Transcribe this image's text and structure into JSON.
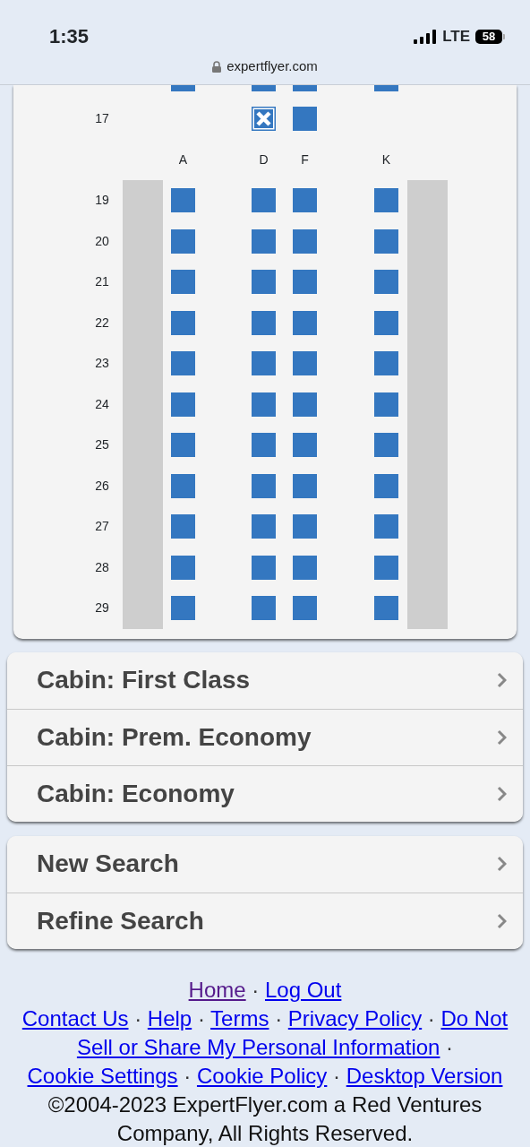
{
  "status_bar": {
    "time": "1:35",
    "network": "LTE",
    "battery": "58"
  },
  "address_bar": {
    "url": "expertflyer.com"
  },
  "seat_map": {
    "columns": [
      "A",
      "D",
      "F",
      "K"
    ],
    "rows": [
      {
        "kind": "partial",
        "seats": [
          {
            "kind": "seat",
            "occupied": false
          },
          {
            "kind": "seat",
            "occupied": false
          },
          {
            "kind": "seat",
            "occupied": false
          },
          {
            "kind": "seat",
            "occupied": false
          }
        ]
      },
      {
        "kind": "seats",
        "number": "17",
        "seats": [
          {
            "kind": "space"
          },
          {
            "kind": "seat",
            "occupied": true
          },
          {
            "kind": "seat",
            "occupied": false
          },
          {
            "kind": "space"
          }
        ]
      },
      {
        "kind": "header"
      },
      {
        "kind": "seats",
        "number": "19",
        "seats": [
          {
            "kind": "seat",
            "occupied": false
          },
          {
            "kind": "seat",
            "occupied": false
          },
          {
            "kind": "seat",
            "occupied": false
          },
          {
            "kind": "seat",
            "occupied": false
          }
        ]
      },
      {
        "kind": "seats",
        "number": "20",
        "seats": [
          {
            "kind": "seat",
            "occupied": false
          },
          {
            "kind": "seat",
            "occupied": false
          },
          {
            "kind": "seat",
            "occupied": false
          },
          {
            "kind": "seat",
            "occupied": false
          }
        ]
      },
      {
        "kind": "seats",
        "number": "21",
        "seats": [
          {
            "kind": "seat",
            "occupied": false
          },
          {
            "kind": "seat",
            "occupied": false
          },
          {
            "kind": "seat",
            "occupied": false
          },
          {
            "kind": "seat",
            "occupied": false
          }
        ]
      },
      {
        "kind": "seats",
        "number": "22",
        "seats": [
          {
            "kind": "seat",
            "occupied": false
          },
          {
            "kind": "seat",
            "occupied": false
          },
          {
            "kind": "seat",
            "occupied": false
          },
          {
            "kind": "seat",
            "occupied": false
          }
        ]
      },
      {
        "kind": "seats",
        "number": "23",
        "seats": [
          {
            "kind": "seat",
            "occupied": false
          },
          {
            "kind": "seat",
            "occupied": false
          },
          {
            "kind": "seat",
            "occupied": false
          },
          {
            "kind": "seat",
            "occupied": false
          }
        ]
      },
      {
        "kind": "seats",
        "number": "24",
        "seats": [
          {
            "kind": "seat",
            "occupied": false
          },
          {
            "kind": "seat",
            "occupied": false
          },
          {
            "kind": "seat",
            "occupied": false
          },
          {
            "kind": "seat",
            "occupied": false
          }
        ]
      },
      {
        "kind": "seats",
        "number": "25",
        "seats": [
          {
            "kind": "seat",
            "occupied": false
          },
          {
            "kind": "seat",
            "occupied": false
          },
          {
            "kind": "seat",
            "occupied": false
          },
          {
            "kind": "seat",
            "occupied": false
          }
        ]
      },
      {
        "kind": "seats",
        "number": "26",
        "seats": [
          {
            "kind": "seat",
            "occupied": false
          },
          {
            "kind": "seat",
            "occupied": false
          },
          {
            "kind": "seat",
            "occupied": false
          },
          {
            "kind": "seat",
            "occupied": false
          }
        ]
      },
      {
        "kind": "seats",
        "number": "27",
        "seats": [
          {
            "kind": "seat",
            "occupied": false
          },
          {
            "kind": "seat",
            "occupied": false
          },
          {
            "kind": "seat",
            "occupied": false
          },
          {
            "kind": "seat",
            "occupied": false
          }
        ]
      },
      {
        "kind": "seats",
        "number": "28",
        "seats": [
          {
            "kind": "seat",
            "occupied": false
          },
          {
            "kind": "seat",
            "occupied": false
          },
          {
            "kind": "seat",
            "occupied": false
          },
          {
            "kind": "seat",
            "occupied": false
          }
        ]
      },
      {
        "kind": "seats",
        "number": "29",
        "seats": [
          {
            "kind": "seat",
            "occupied": false
          },
          {
            "kind": "seat",
            "occupied": false
          },
          {
            "kind": "seat",
            "occupied": false
          },
          {
            "kind": "seat",
            "occupied": false
          }
        ]
      }
    ]
  },
  "cabins": [
    "Cabin: First Class",
    "Cabin: Prem. Economy",
    "Cabin: Economy"
  ],
  "actions": [
    "New Search",
    "Refine Search"
  ],
  "footer": [
    {
      "kind": "link",
      "text": "Home",
      "visited": true
    },
    {
      "kind": "separator",
      "text": "·"
    },
    {
      "kind": "link",
      "text": "Log Out",
      "visited": false
    },
    {
      "kind": "break"
    },
    {
      "kind": "link",
      "text": "Contact Us",
      "visited": false
    },
    {
      "kind": "separator",
      "text": "·"
    },
    {
      "kind": "link",
      "text": "Help",
      "visited": false
    },
    {
      "kind": "separator",
      "text": "·"
    },
    {
      "kind": "link",
      "text": "Terms",
      "visited": false
    },
    {
      "kind": "separator",
      "text": "·"
    },
    {
      "kind": "link",
      "text": "Privacy Policy",
      "visited": false
    },
    {
      "kind": "separator",
      "text": "·"
    },
    {
      "kind": "link",
      "text": "Do Not",
      "visited": false
    },
    {
      "kind": "break"
    },
    {
      "kind": "link",
      "text": "Sell or Share My Personal Information",
      "visited": false
    },
    {
      "kind": "separator",
      "text": "·"
    },
    {
      "kind": "break"
    },
    {
      "kind": "link",
      "text": "Cookie Settings",
      "visited": false
    },
    {
      "kind": "separator",
      "text": "·"
    },
    {
      "kind": "link",
      "text": "Cookie Policy",
      "visited": false
    },
    {
      "kind": "separator",
      "text": "·"
    },
    {
      "kind": "link",
      "text": "Desktop Version",
      "visited": false
    },
    {
      "kind": "break"
    },
    {
      "kind": "text",
      "text": "©2004-2023 ExpertFlyer.com a Red Ventures Company, All Rights Reserved."
    }
  ]
}
